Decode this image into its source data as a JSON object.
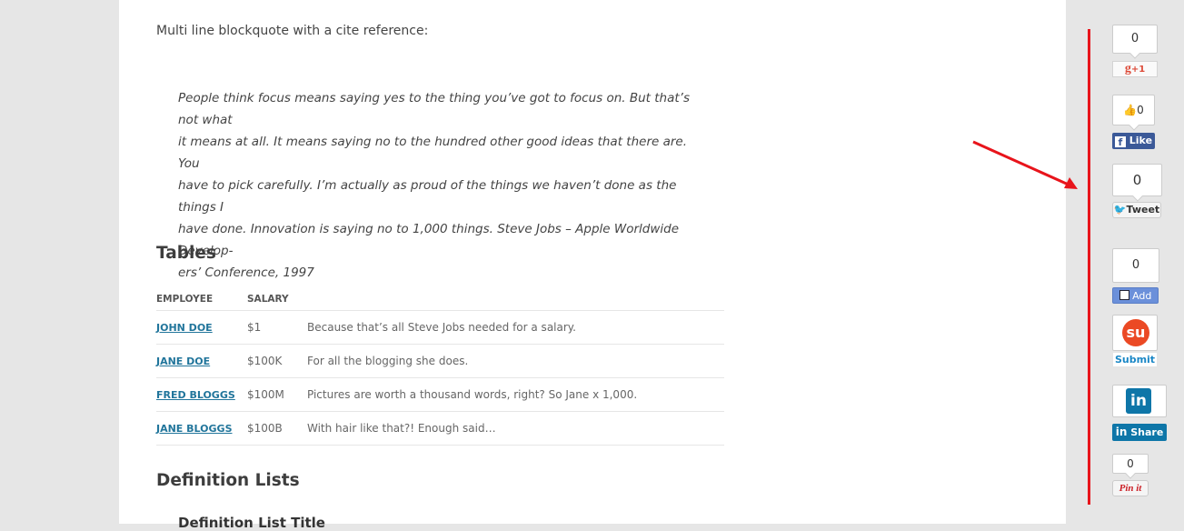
{
  "content": {
    "intro": "Multi line blockquote with a cite reference:",
    "quote_lines": [
      "People think focus means saying yes to the thing you’ve got to focus on. But that’s not what",
      "it means at all. It means saying no to the hundred other good ideas that there are. You",
      "have to pick carefully. I’m actually as proud of the things we haven’t done as the things I",
      "have done. Innovation is saying no to 1,000 things. Steve Jobs – Apple Worldwide Develop-",
      "ers’ Conference, 1997"
    ],
    "tables_heading": "Tables",
    "table": {
      "headers": [
        "EMPLOYEE",
        "SALARY",
        ""
      ],
      "rows": [
        {
          "employee": "JOHN DOE",
          "salary": "$1",
          "note": "Because that’s all Steve Jobs needed for a salary."
        },
        {
          "employee": "JANE DOE",
          "salary": "$100K",
          "note": "For all the blogging she does."
        },
        {
          "employee": "FRED BLOGGS",
          "salary": "$100M",
          "note": "Pictures are worth a thousand words, right? So Jane x 1,000."
        },
        {
          "employee": "JANE BLOGGS",
          "salary": "$100B",
          "note": "With hair like that?! Enough said…"
        }
      ]
    },
    "deflists_heading": "Definition Lists",
    "deflist_title": "Definition List Title"
  },
  "share": {
    "google": {
      "count": "0",
      "label": "+1",
      "color": "#dd4b39"
    },
    "facebook": {
      "count": "0",
      "label": "Like",
      "color": "#3b5998"
    },
    "twitter": {
      "count": "0",
      "label": "Tweet",
      "color": "#1da1f2"
    },
    "addthis": {
      "count": "0",
      "label": "Add",
      "color": "#6b90da"
    },
    "stumbleupon": {
      "label": "Submit",
      "color": "#eb4924"
    },
    "linkedin": {
      "label": "Share",
      "color": "#0e76a8"
    },
    "pinterest": {
      "count": "0",
      "label": "Pin it",
      "color": "#cb2027"
    }
  },
  "annotation_color": "#e8141b"
}
